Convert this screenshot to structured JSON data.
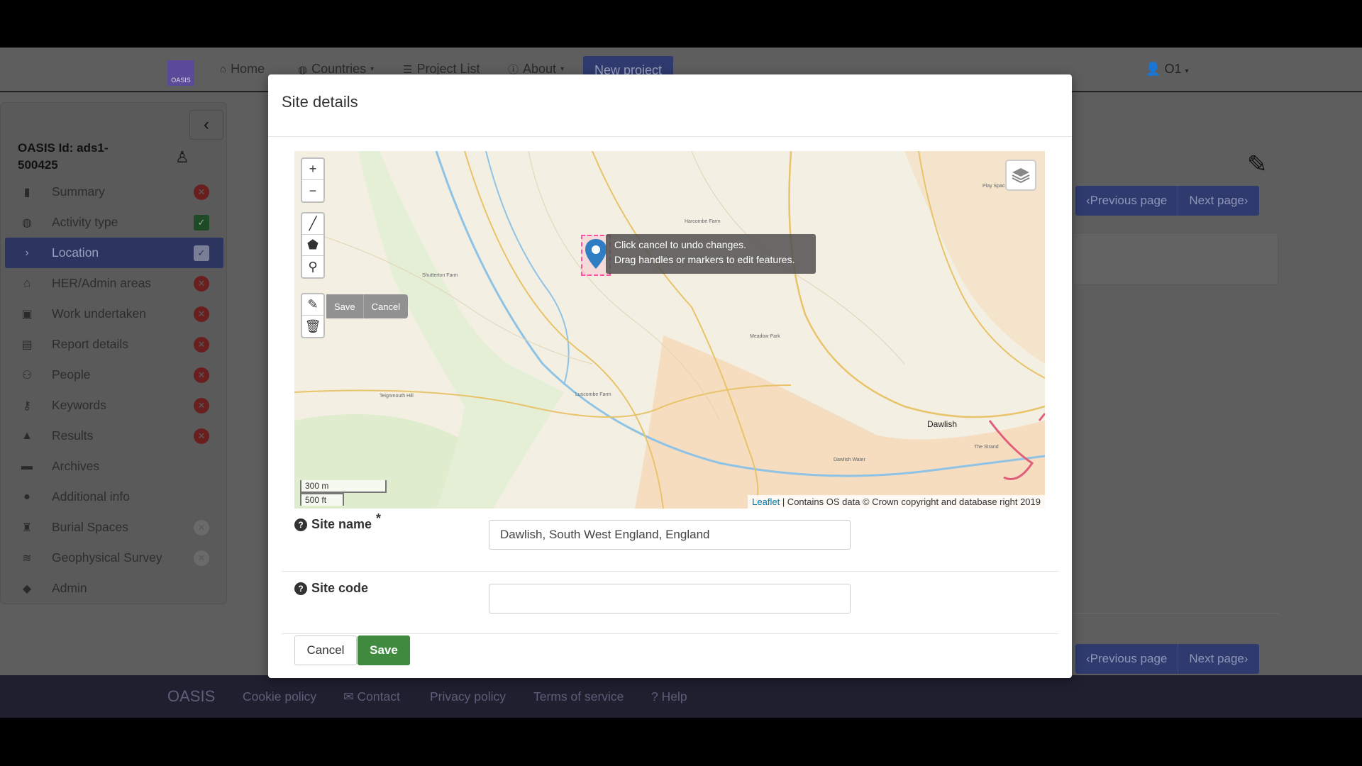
{
  "navbar": {
    "logo_text": "OASIS",
    "home": "Home",
    "countries": "Countries",
    "project_list": "Project List",
    "about": "About",
    "new_project": "New project",
    "user": "O1"
  },
  "sidebar": {
    "oasis_id": "OASIS Id: ads1-500425",
    "items": [
      {
        "label": "Summary",
        "status": "incomplete"
      },
      {
        "label": "Activity type",
        "status": "complete"
      },
      {
        "label": "Location",
        "status": "complete"
      },
      {
        "label": "HER/Admin areas",
        "status": "incomplete"
      },
      {
        "label": "Work undertaken",
        "status": "incomplete"
      },
      {
        "label": "Report details",
        "status": "incomplete"
      },
      {
        "label": "People",
        "status": "incomplete"
      },
      {
        "label": "Keywords",
        "status": "incomplete"
      },
      {
        "label": "Results",
        "status": "incomplete"
      },
      {
        "label": "Archives",
        "status": "none"
      },
      {
        "label": "Additional info",
        "status": "none"
      },
      {
        "label": "Burial Spaces",
        "status": "disabled"
      },
      {
        "label": "Geophysical Survey",
        "status": "disabled"
      },
      {
        "label": "Admin",
        "status": "none"
      }
    ]
  },
  "pager": {
    "previous": "Previous page",
    "next": "Next page"
  },
  "footer": {
    "brand": "OASIS",
    "cookie": "Cookie policy",
    "contact": "Contact",
    "privacy": "Privacy policy",
    "terms": "Terms of service",
    "help": "Help"
  },
  "modal": {
    "title": "Site details",
    "map": {
      "edit_save": "Save",
      "edit_cancel": "Cancel",
      "tooltip_line1": "Click cancel to undo changes.",
      "tooltip_line2": "Drag handles or markers to edit features.",
      "scale_metric": "300 m",
      "scale_imperial": "500 ft",
      "attribution_link": "Leaflet",
      "attribution_text": " | Contains OS data © Crown copyright and database right 2019",
      "town_label": "Dawlish",
      "place_labels": [
        "Shutterton Farm",
        "Harcombe Farm",
        "Luscombe Farm",
        "Dawlish Water",
        "Play Space",
        "Meadow Park",
        "The Strand",
        "Teignmouth Hill"
      ]
    },
    "site_name": {
      "label": "Site name",
      "required_mark": "*",
      "value": "Dawlish, South West England, England"
    },
    "site_code": {
      "label": "Site code",
      "value": ""
    },
    "cancel_label": "Cancel",
    "save_label": "Save"
  }
}
